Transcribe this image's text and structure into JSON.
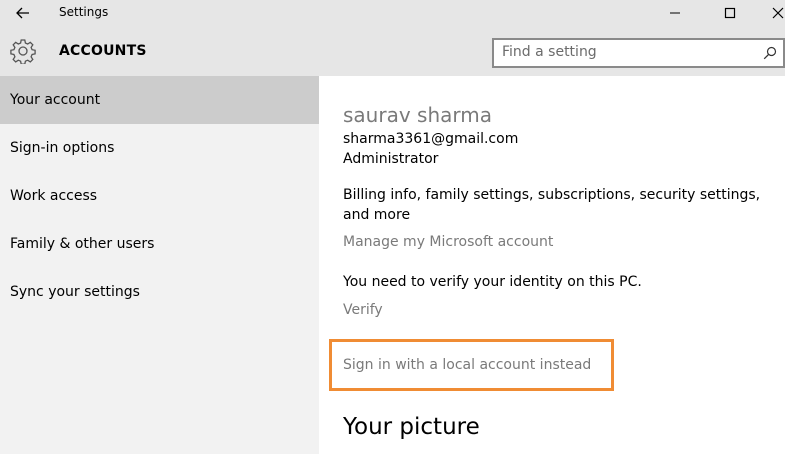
{
  "window": {
    "title": "Settings"
  },
  "header": {
    "title": "ACCOUNTS",
    "search_placeholder": "Find a setting"
  },
  "sidebar": {
    "items": [
      {
        "label": "Your account",
        "selected": true
      },
      {
        "label": "Sign-in options",
        "selected": false
      },
      {
        "label": "Work access",
        "selected": false
      },
      {
        "label": "Family & other users",
        "selected": false
      },
      {
        "label": "Sync your settings",
        "selected": false
      }
    ]
  },
  "account": {
    "name": "saurav sharma",
    "email": "sharma3361@gmail.com",
    "role": "Administrator",
    "billing_text": "Billing info, family settings, subscriptions, security settings, and more",
    "manage_link": "Manage my Microsoft account",
    "verify_message": "You need to verify your identity on this PC.",
    "verify_link": "Verify",
    "local_account_link": "Sign in with a local account instead"
  },
  "picture_section": {
    "title": "Your picture"
  },
  "colors": {
    "highlight": "#f08c34",
    "link": "#7a7a7a",
    "sidebar_bg": "#f2f2f2",
    "selected_bg": "#cccccc",
    "header_bg": "#e6e6e6"
  },
  "icons": {
    "back": "back-arrow-icon",
    "settings": "gear-icon",
    "search": "search-icon",
    "minimize": "minimize-icon",
    "maximize": "maximize-icon",
    "close": "close-icon"
  }
}
